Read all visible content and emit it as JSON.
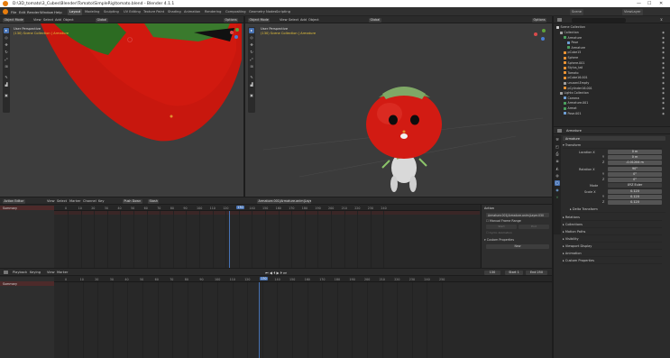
{
  "window": {
    "title": "D:\\3D_tomato\\3_Cubes\\Blender\\Tomato\\SimpleRig\\tomato.blend - Blender 4.1.1",
    "minimize": "—",
    "maximize": "☐",
    "close": "✕"
  },
  "menu": {
    "items": [
      "File",
      "Edit",
      "Render",
      "Window",
      "Help"
    ],
    "workspaces": [
      "Layout",
      "Modeling",
      "Sculpting",
      "UV Editing",
      "Texture Paint",
      "Shading",
      "Animation",
      "Rendering",
      "Compositing",
      "Geometry Nodes",
      "Scripting"
    ],
    "active_workspace": "Layout",
    "scene": "Scene",
    "view_layer": "ViewLayer"
  },
  "viewport_left": {
    "mode": "Object Mode",
    "menus": [
      "View",
      "Select",
      "Add",
      "Object"
    ],
    "transform": "Global",
    "options": "Options",
    "view_name": "User Perspective",
    "collection": "(130) Scene Collection | Armature"
  },
  "viewport_right": {
    "mode": "Object Mode",
    "menus": [
      "View",
      "Select",
      "Add",
      "Object"
    ],
    "transform": "Global",
    "options": "Options",
    "view_name": "User Perspective",
    "collection": "(130) Scene Collection | Armature"
  },
  "outliner": {
    "title": "Scene Collection",
    "items": [
      {
        "label": "Collection",
        "depth": 1,
        "color": "#a0a0a0"
      },
      {
        "label": "Armature",
        "depth": 2,
        "color": "#4aa05e"
      },
      {
        "label": "Pose",
        "depth": 3,
        "color": "#6e9fd6"
      },
      {
        "label": "Armature",
        "depth": 3,
        "color": "#4aa05e"
      },
      {
        "label": "pCube15",
        "depth": 2,
        "color": "#e89233"
      },
      {
        "label": "Sphere",
        "depth": 2,
        "color": "#e89233"
      },
      {
        "label": "Sphere.001",
        "depth": 2,
        "color": "#e89233"
      },
      {
        "label": "Stylus_tail",
        "depth": 2,
        "color": "#e89233"
      },
      {
        "label": "Tomato",
        "depth": 2,
        "color": "#e89233"
      },
      {
        "label": "pCube16.001",
        "depth": 2,
        "color": "#e89233"
      },
      {
        "label": "unused.Empty",
        "depth": 2,
        "color": "#a0a0a0"
      },
      {
        "label": "pCylinder16.001",
        "depth": 2,
        "color": "#e89233"
      },
      {
        "label": "Lights Collection",
        "depth": 1,
        "color": "#a0a0a0"
      },
      {
        "label": "Camera",
        "depth": 2,
        "color": "#6e9fd6"
      },
      {
        "label": "Armature.001",
        "depth": 2,
        "color": "#4aa05e"
      },
      {
        "label": "Armat",
        "depth": 2,
        "color": "#4aa05e"
      },
      {
        "label": "Pose.001",
        "depth": 2,
        "color": "#6e9fd6"
      }
    ]
  },
  "properties": {
    "object_name": "Armature",
    "search_placeholder": "Armature",
    "sections": {
      "transform": "Transform",
      "delta": "Delta Transform",
      "relations": "Relations",
      "collections": "Collections",
      "motion_paths": "Motion Paths",
      "visibility": "Visibility",
      "viewport_display": "Viewport Display",
      "animation": "Animation",
      "custom_props": "Custom Properties"
    },
    "location_label": "Location X",
    "loc": [
      "0 m",
      "0 m",
      "-0.01204 m"
    ],
    "rotation_label": "Rotation X",
    "rot": [
      "90°",
      "0°",
      "0°"
    ],
    "mode_label": "Mode",
    "mode": "XYZ Euler",
    "scale_label": "Scale X",
    "scale": [
      "0.120",
      "0.120",
      "0.120"
    ],
    "axis": [
      "Y",
      "Z"
    ]
  },
  "action_editor": {
    "mode": "Action Editor",
    "menus": [
      "View",
      "Select",
      "Marker",
      "Channel",
      "Key"
    ],
    "push_down": "Push Down",
    "stash": "Stash",
    "action": "Armature.001|Armature.anim|Layer.030",
    "summary": "Summary",
    "sidebar": {
      "title": "Action",
      "action_name": "Armature.001|Armature.anim|Layer.030",
      "manual_frame": "Manual Frame Range",
      "start": "Start",
      "end": "End",
      "cyclic": "Cyclic Animation",
      "custom_props": "Custom Properties",
      "new": "New"
    },
    "frames": [
      "0",
      "10",
      "20",
      "30",
      "40",
      "50",
      "60",
      "70",
      "80",
      "90",
      "100",
      "110",
      "120",
      "130",
      "140",
      "150",
      "160",
      "170",
      "180",
      "190",
      "200",
      "210",
      "220",
      "230",
      "240"
    ],
    "current_frame": "130"
  },
  "timeline": {
    "menus": [
      "Playback",
      "Keying",
      "View",
      "Marker"
    ],
    "current": "130",
    "start_label": "Start",
    "start": "1",
    "end_label": "End",
    "end": "250",
    "summary": "Summary",
    "frames": [
      "0",
      "10",
      "20",
      "30",
      "40",
      "50",
      "60",
      "70",
      "80",
      "90",
      "100",
      "110",
      "120",
      "130",
      "140",
      "150",
      "160",
      "170",
      "180",
      "190",
      "200",
      "210",
      "220",
      "230",
      "240",
      "250"
    ],
    "current_frame": "130"
  }
}
